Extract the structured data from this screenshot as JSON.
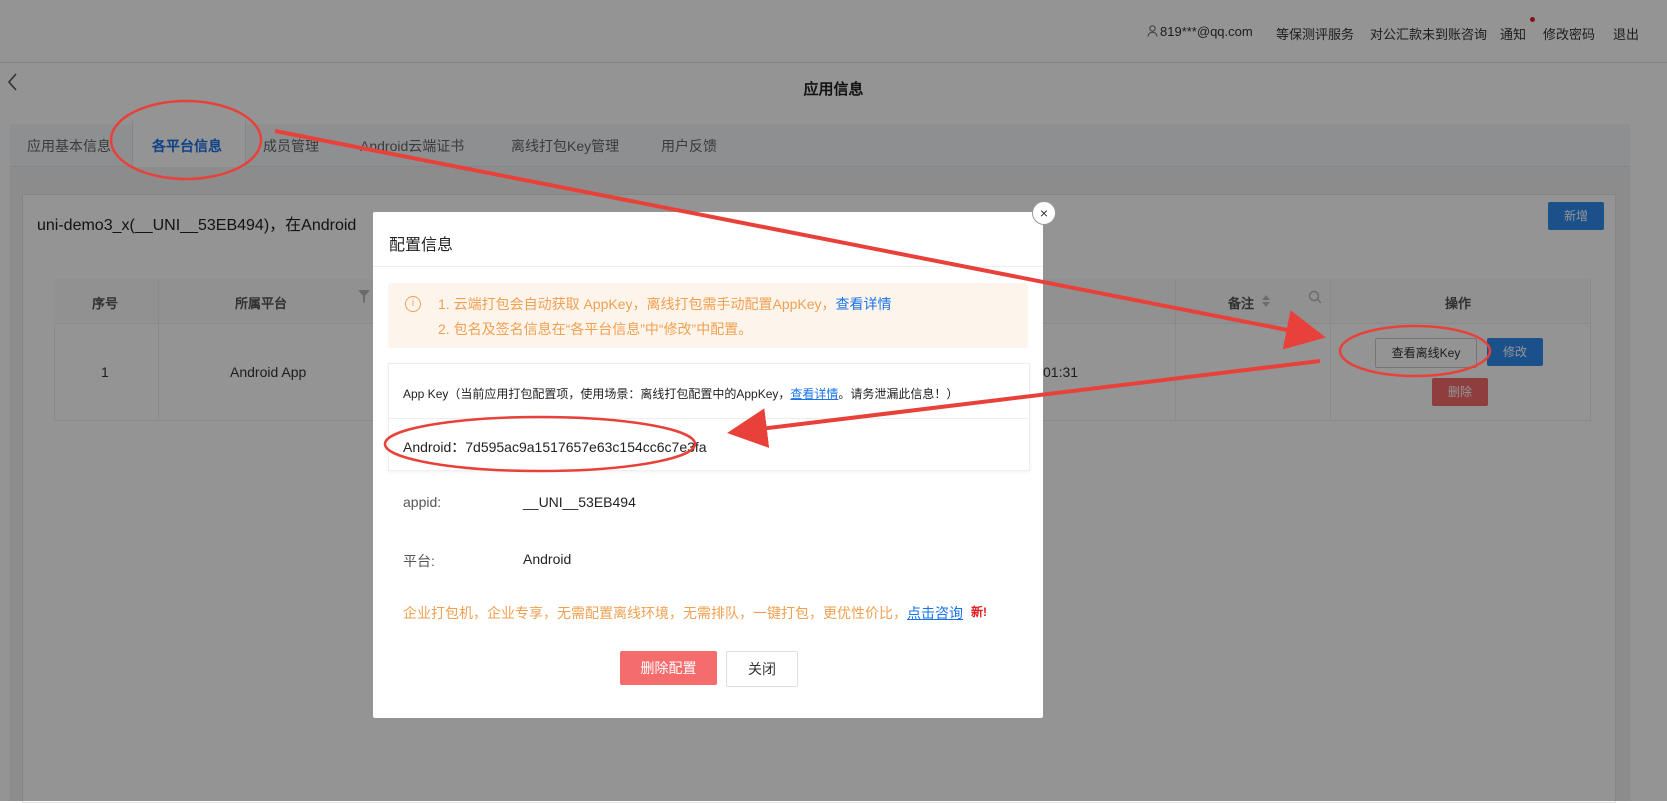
{
  "topbar": {
    "user_email": "819***@qq.com",
    "links": [
      "等保测评服务",
      "对公汇款未到账咨询",
      "通知",
      "修改密码",
      "退出"
    ]
  },
  "header": {
    "title": "应用信息"
  },
  "tabs": [
    {
      "label": "应用基本信息"
    },
    {
      "label": "各平台信息"
    },
    {
      "label": "成员管理"
    },
    {
      "label": "Android云端证书"
    },
    {
      "label": "离线打包Key管理"
    },
    {
      "label": "用户反馈"
    }
  ],
  "card": {
    "title": "uni-demo3_x(__UNI__53EB494)，在Android",
    "add_button": "新增"
  },
  "table": {
    "headers": {
      "index": "序号",
      "platform": "所属平台",
      "remark": "备注",
      "actions": "操作"
    },
    "row": {
      "index": "1",
      "platform": "Android App",
      "time_partial": "01:31",
      "view_key_button": "查看离线Key",
      "edit_button": "修改",
      "delete_button": "删除"
    }
  },
  "modal": {
    "title": "配置信息",
    "close_glyph": "×",
    "notice": {
      "line1_text": "1. 云端打包会自动获取 AppKey，离线打包需手动配置AppKey，",
      "line1_link": "查看详情",
      "line2_text": "2. 包名及签名信息在“各平台信息”中“修改”中配置。"
    },
    "appkey": {
      "head_prefix": "App Key（当前应用打包配置项，使用场景：离线打包配置中的AppKey，",
      "head_link": "查看详情",
      "head_suffix": "。请务泄漏此信息！）",
      "value": "Android：7d595ac9a1517657e63c154cc6c7e3fa"
    },
    "appid_label": "appid:",
    "appid_value": "__UNI__53EB494",
    "platform_label": "平台:",
    "platform_value": "Android",
    "promo_text": "企业打包机，企业专享，无需配置离线环境，无需排队，一键打包，更优性价比，",
    "promo_link": "点击咨询",
    "promo_new": "新!",
    "delete_button": "删除配置",
    "close_button": "关闭"
  },
  "colors": {
    "primary": "#2d8cf0",
    "danger": "#f56c6c",
    "warning": "#f0a050",
    "annotation": "#e8413a"
  },
  "icons": [
    "user-icon",
    "back-arrow-icon",
    "filter-icon",
    "sort-icon",
    "search-icon",
    "info-icon",
    "close-icon"
  ]
}
